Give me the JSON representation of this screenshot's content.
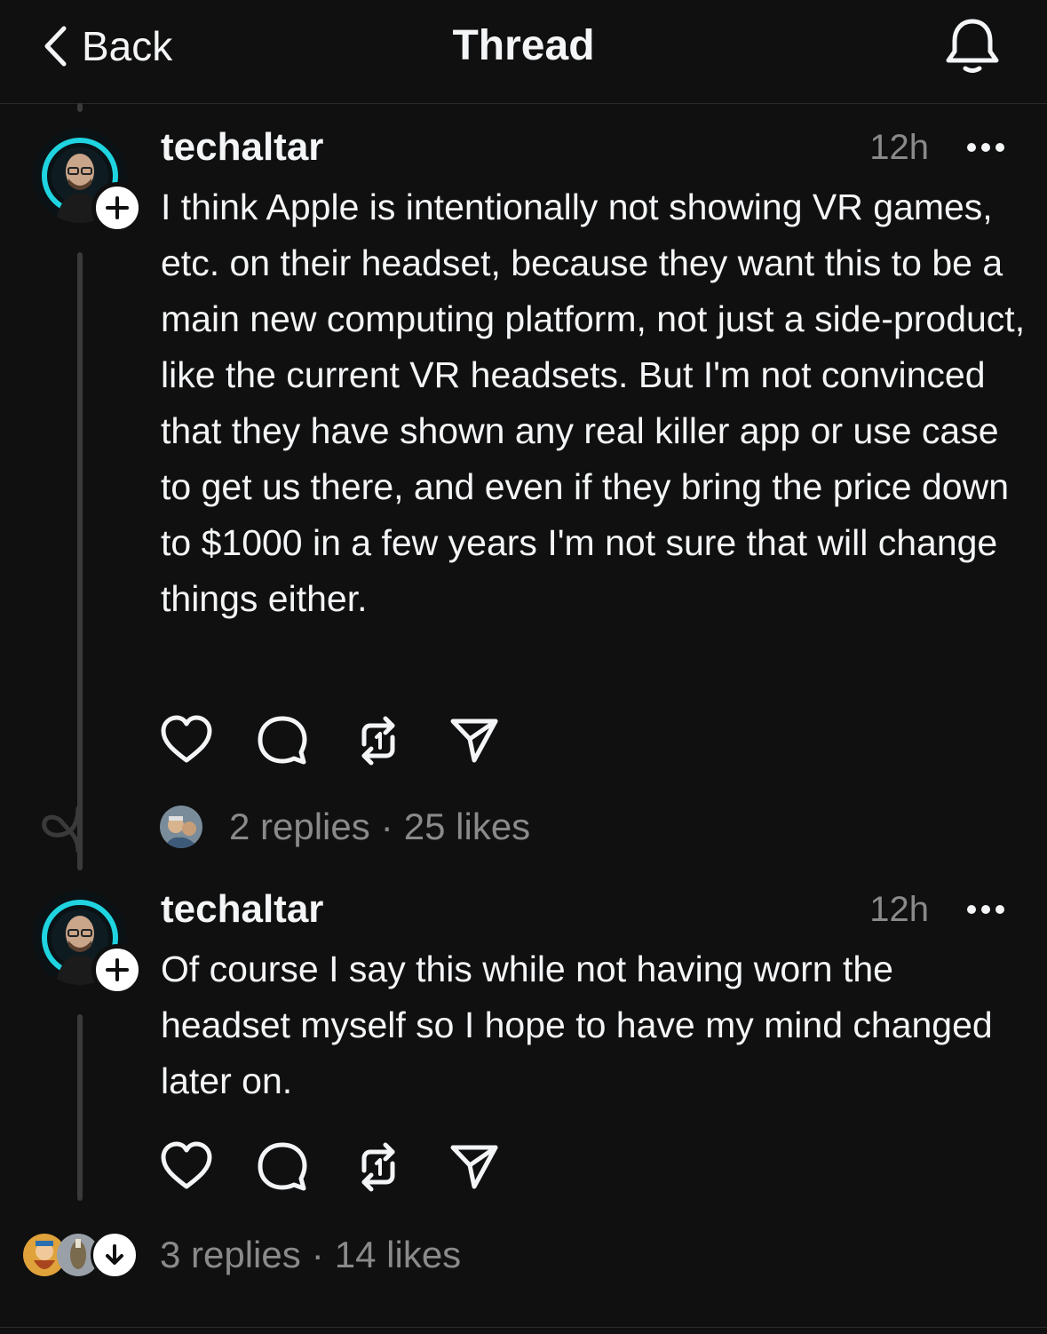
{
  "header": {
    "back_label": "Back",
    "title": "Thread"
  },
  "posts": [
    {
      "username": "techaltar",
      "time": "12h",
      "text": "I think Apple is intentionally not showing VR games, etc. on their headset, because they want this to be a main new computing platform, not just a side-product, like the current VR headsets. But I'm not convinced that they have shown any real killer app or use case to get us there, and even if they bring the price down to $1000 in a few years I'm not sure that will change things either.",
      "replies": "2 replies",
      "separator": "·",
      "likes": "25 likes"
    },
    {
      "username": "techaltar",
      "time": "12h",
      "text": "Of course I say this while not having worn the headset myself so I hope to have my mind changed later on.",
      "replies": "3 replies",
      "separator": "·",
      "likes": "14 likes"
    }
  ],
  "colors": {
    "background": "#101010",
    "text": "#f3f5f7",
    "muted": "#8a8a8a",
    "thread_line": "#3a3a3a",
    "avatar_ring": "#1fd4e0"
  },
  "icons": [
    "chevron-left-icon",
    "bell-icon",
    "plus-icon",
    "more-icon",
    "heart-icon",
    "comment-icon",
    "repost-icon",
    "share-icon",
    "arrow-down-icon"
  ]
}
